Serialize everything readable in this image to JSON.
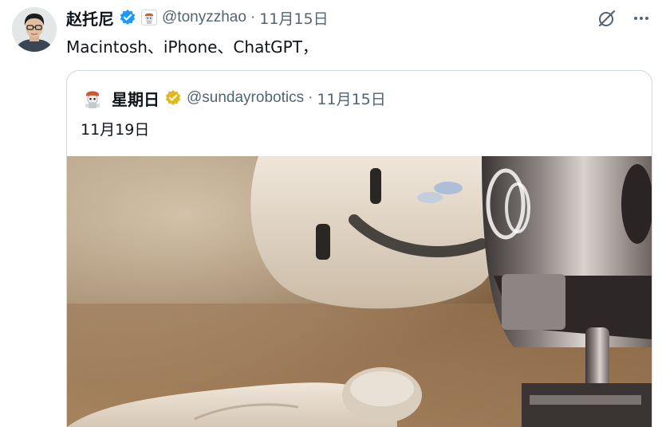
{
  "tweet": {
    "author_name": "赵托尼",
    "author_handle": "@tonyzzhao",
    "separator": "·",
    "date": "11月15日",
    "text": "Macintosh、iPhone、ChatGPT，"
  },
  "quoted_tweet": {
    "author_name": "星期日",
    "author_handle": "@sundayrobotics",
    "separator": "·",
    "date": "11月15日",
    "text": "11月19日"
  },
  "icons": {
    "verified": "verified-badge-icon",
    "gold_verified": "gold-verified-badge-icon",
    "grok": "grok-icon",
    "more": "more-icon"
  },
  "colors": {
    "verified_blue": "#1d9bf0",
    "gold": "#e2b719",
    "secondary_text": "#536471",
    "border": "#cfd9de"
  }
}
